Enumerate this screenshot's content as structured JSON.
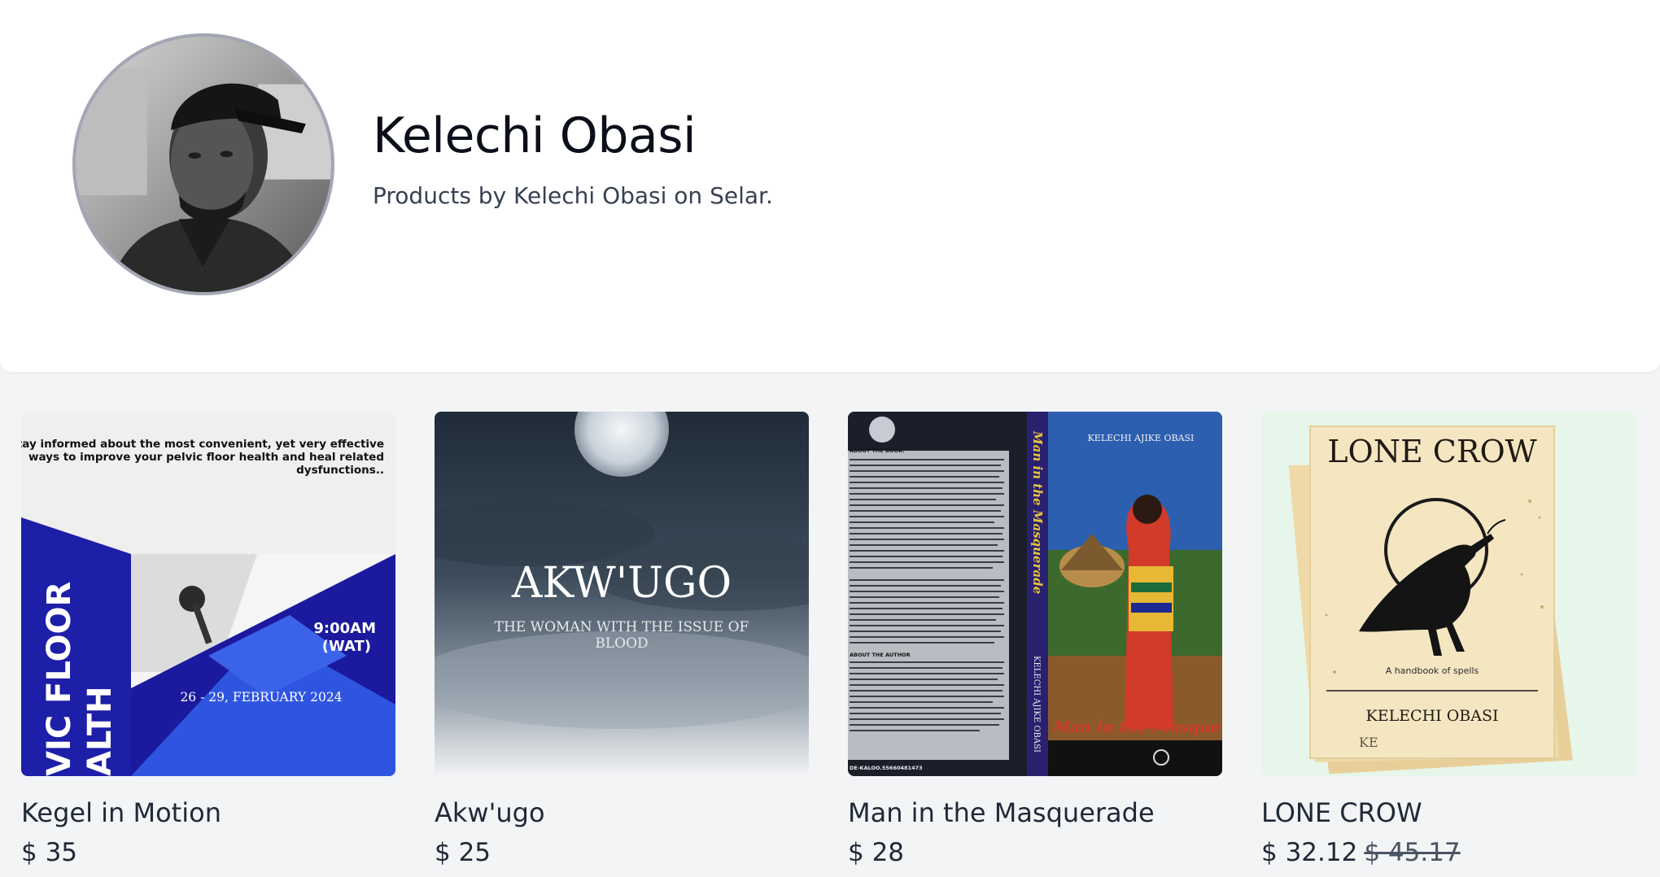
{
  "store": {
    "name": "Kelechi Obasi",
    "description": "Products by Kelechi Obasi on Selar."
  },
  "products": [
    {
      "title": "Kegel in Motion",
      "price": "$ 35",
      "cover": {
        "intro": [
          "Stay informed about the most convenient, yet very effective",
          "ways to improve your pelvic floor health and heal related",
          "dysfunctions.."
        ],
        "time": [
          "9:00AM",
          "(WAT)"
        ],
        "dates": "26 - 29, FEBRUARY 2024",
        "side_text": [
          "VIC FLOOR",
          "ALTH"
        ]
      }
    },
    {
      "title": "Akw'ugo",
      "price": "$ 25",
      "cover": {
        "heading": "AKW'UGO",
        "subtitle": [
          "THE WOMAN WITH THE ISSUE OF",
          "BLOOD"
        ]
      }
    },
    {
      "title": "Man in the Masquerade",
      "price": "$ 28",
      "cover": {
        "author": "KELECHI AJIKE OBASI",
        "spine_title": "Man in the Masquerade",
        "spine_author": "KELECHI AJIKE OBASI",
        "front_title": "Man in the Masque",
        "about_book": "ABOUT THE BOOK:",
        "about_author": "ABOUT THE AUTHOR",
        "isbn": "DE-KALOO.55660481473"
      }
    },
    {
      "title": "LONE CROW",
      "price": "$ 32.12",
      "old_price": "$ 45.17",
      "cover": {
        "heading": "LONE CROW",
        "tagline": "A handbook of spells",
        "author": "KELECHI OBASI",
        "back_fragment": "KE"
      }
    }
  ]
}
